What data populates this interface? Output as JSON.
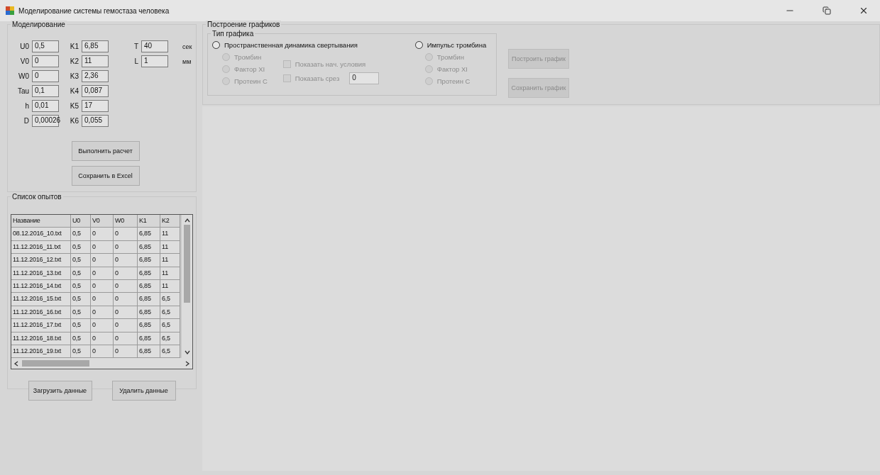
{
  "window": {
    "title": "Моделирование системы гемостаза человека"
  },
  "modeling": {
    "title": "Моделирование",
    "columns": [
      [
        {
          "label": "U0",
          "value": "0,5"
        },
        {
          "label": "V0",
          "value": "0"
        },
        {
          "label": "W0",
          "value": "0"
        },
        {
          "label": "Tau",
          "value": "0,1"
        },
        {
          "label": "h",
          "value": "0,01"
        },
        {
          "label": "D",
          "value": "0,00026"
        }
      ],
      [
        {
          "label": "K1",
          "value": "6,85"
        },
        {
          "label": "K2",
          "value": "11"
        },
        {
          "label": "K3",
          "value": "2,36"
        },
        {
          "label": "K4",
          "value": "0,087"
        },
        {
          "label": "K5",
          "value": "17"
        },
        {
          "label": "K6",
          "value": "0,055"
        }
      ],
      [
        {
          "label": "T",
          "value": "40",
          "unit": "сек"
        },
        {
          "label": "L",
          "value": "1",
          "unit": "мм"
        }
      ]
    ],
    "buttons": [
      "Выполнить расчет",
      "Сохранить в Excel"
    ]
  },
  "experiments": {
    "title": "Список опытов",
    "columns": [
      "Название",
      "U0",
      "V0",
      "W0",
      "K1",
      "K2"
    ],
    "rows": [
      [
        "08.12.2016_10.txt",
        "0,5",
        "0",
        "0",
        "6,85",
        "11"
      ],
      [
        "11.12.2016_11.txt",
        "0,5",
        "0",
        "0",
        "6,85",
        "11"
      ],
      [
        "11.12.2016_12.txt",
        "0,5",
        "0",
        "0",
        "6,85",
        "11"
      ],
      [
        "11.12.2016_13.txt",
        "0,5",
        "0",
        "0",
        "6,85",
        "11"
      ],
      [
        "11.12.2016_14.txt",
        "0,5",
        "0",
        "0",
        "6,85",
        "11"
      ],
      [
        "11.12.2016_15.txt",
        "0,5",
        "0",
        "0",
        "6,85",
        "6,5"
      ],
      [
        "11.12.2016_16.txt",
        "0,5",
        "0",
        "0",
        "6,85",
        "6,5"
      ],
      [
        "11.12.2016_17.txt",
        "0,5",
        "0",
        "0",
        "6,85",
        "6,5"
      ],
      [
        "11.12.2016_18.txt",
        "0,5",
        "0",
        "0",
        "6,85",
        "6,5"
      ],
      [
        "11.12.2016_19.txt",
        "0,5",
        "0",
        "0",
        "6,85",
        "6,5"
      ]
    ],
    "buttons": [
      "Загрузить данные",
      "Удалить данные"
    ]
  },
  "plotting": {
    "title": "Построение графиков",
    "type_group": "Тип графика",
    "modes": [
      {
        "label": "Пространственная динамика свертывания",
        "selected": false,
        "options": [
          {
            "label": "Тромбин",
            "selected": false,
            "disabled": true
          },
          {
            "label": "Фактор XI",
            "selected": false,
            "disabled": true
          },
          {
            "label": "Протеин C",
            "selected": false,
            "disabled": true
          }
        ],
        "checks": [
          {
            "label": "Показать нач. условия",
            "checked": false,
            "disabled": true
          },
          {
            "label": "Показать срез",
            "checked": false,
            "disabled": true,
            "value": "0"
          }
        ]
      },
      {
        "label": "Импульс тромбина",
        "selected": false,
        "options": [
          {
            "label": "Тромбин",
            "selected": false,
            "disabled": true
          },
          {
            "label": "Фактор XI",
            "selected": false,
            "disabled": true
          },
          {
            "label": "Протеин C",
            "selected": false,
            "disabled": true
          }
        ]
      }
    ],
    "buttons": [
      {
        "label": "Построить график",
        "disabled": true
      },
      {
        "label": "Сохранить график",
        "disabled": true
      }
    ]
  }
}
